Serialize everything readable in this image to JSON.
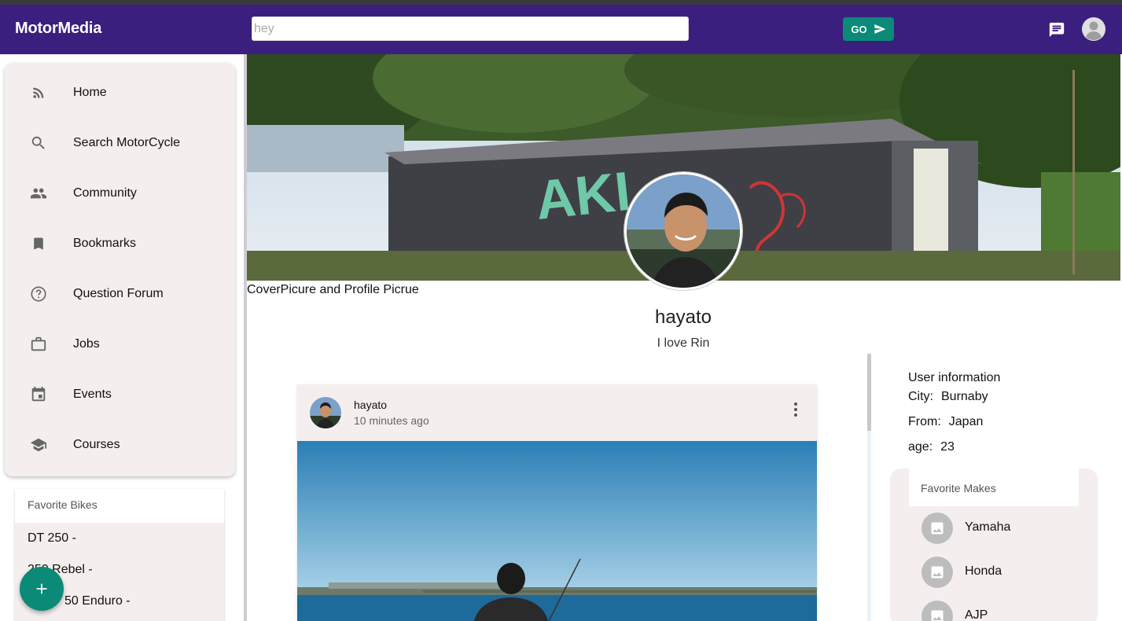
{
  "app": {
    "brand": "MotorMedia"
  },
  "search": {
    "value": "",
    "placeholder": "hey",
    "go_label": "GO"
  },
  "nav": {
    "items": [
      {
        "label": "Home",
        "icon": "rss-feed-icon"
      },
      {
        "label": "Search MotorCycle",
        "icon": "search-icon"
      },
      {
        "label": "Community",
        "icon": "people-icon"
      },
      {
        "label": "Bookmarks",
        "icon": "bookmark-icon"
      },
      {
        "label": "Question Forum",
        "icon": "help-circle-icon"
      },
      {
        "label": "Jobs",
        "icon": "briefcase-icon"
      },
      {
        "label": "Events",
        "icon": "calendar-icon"
      },
      {
        "label": "Courses",
        "icon": "school-icon"
      }
    ]
  },
  "favorite_bikes": {
    "title": "Favorite Bikes",
    "items": [
      "DT 250 -",
      "250 Rebel -",
      "50 Enduro -"
    ]
  },
  "profile": {
    "cover_caption": "CoverPicure and Profile Picrue",
    "username": "hayato",
    "bio": "I love Rin"
  },
  "post": {
    "author": "hayato",
    "time": "10 minutes ago"
  },
  "user_info": {
    "title": "User information",
    "city_label": "City:",
    "city": "Burnaby",
    "from_label": "From:",
    "from": "Japan",
    "age_label": "age:",
    "age": "23"
  },
  "favorite_makes": {
    "title": "Favorite Makes",
    "items": [
      "Yamaha",
      "Honda",
      "AJP"
    ]
  },
  "colors": {
    "appbar": "#3b1f7f",
    "accent": "#0b8a78",
    "card_bg": "#f4efee"
  }
}
